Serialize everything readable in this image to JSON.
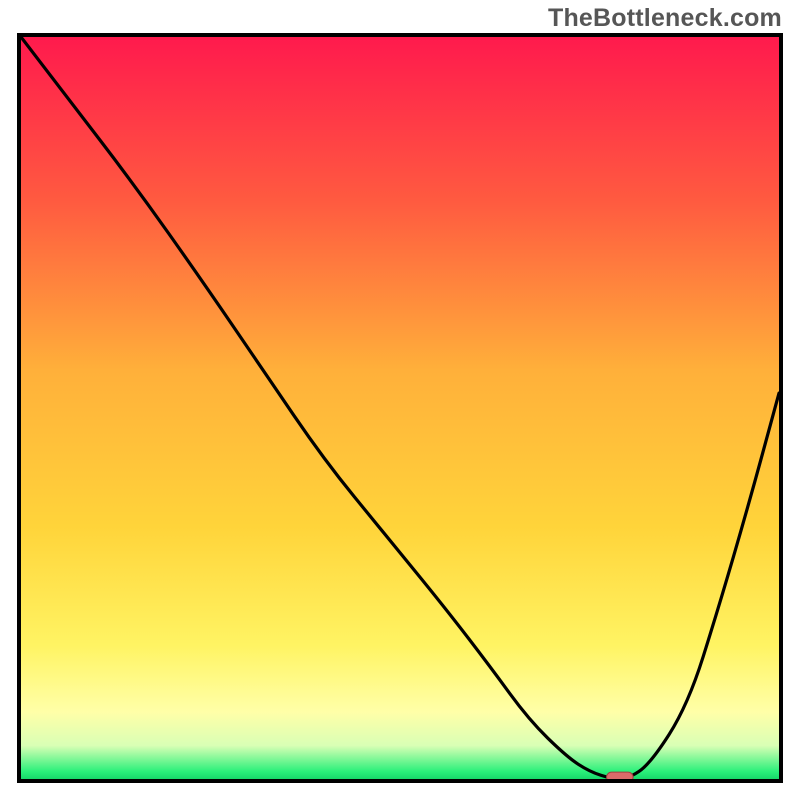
{
  "watermark": "TheBottleneck.com",
  "colors": {
    "frame": "#000000",
    "line": "#000000",
    "marker_fill": "#db6b6a",
    "marker_stroke": "#a04241",
    "grad_top": "#ff1a4d",
    "grad_mid1": "#ff6b3a",
    "grad_mid2": "#ffd43a",
    "grad_yellow": "#fff463",
    "grad_paleyellow": "#ffffa8",
    "grad_palegreen": "#d9ffb5",
    "grad_green": "#2af07a"
  },
  "chart_data": {
    "type": "line",
    "title": "",
    "xlabel": "",
    "ylabel": "",
    "xlim": [
      0,
      100
    ],
    "ylim": [
      0,
      100
    ],
    "grid": false,
    "legend": false,
    "categories_note": "no tick labels or axis labels shown",
    "series": [
      {
        "name": "bottleneck-curve",
        "x": [
          0,
          6,
          15,
          24,
          32,
          40,
          48,
          56,
          62,
          67,
          72,
          75,
          78,
          80,
          83,
          88,
          92,
          96,
          100
        ],
        "y": [
          100,
          92,
          80,
          67,
          55,
          43,
          33,
          23,
          15,
          8,
          3,
          1,
          0,
          0,
          2,
          10,
          23,
          37,
          52
        ]
      }
    ],
    "markers": [
      {
        "name": "min-point-pill",
        "shape": "pill",
        "x": 79,
        "y": 0,
        "width_frac": 0.035,
        "height_frac": 0.013
      }
    ]
  }
}
